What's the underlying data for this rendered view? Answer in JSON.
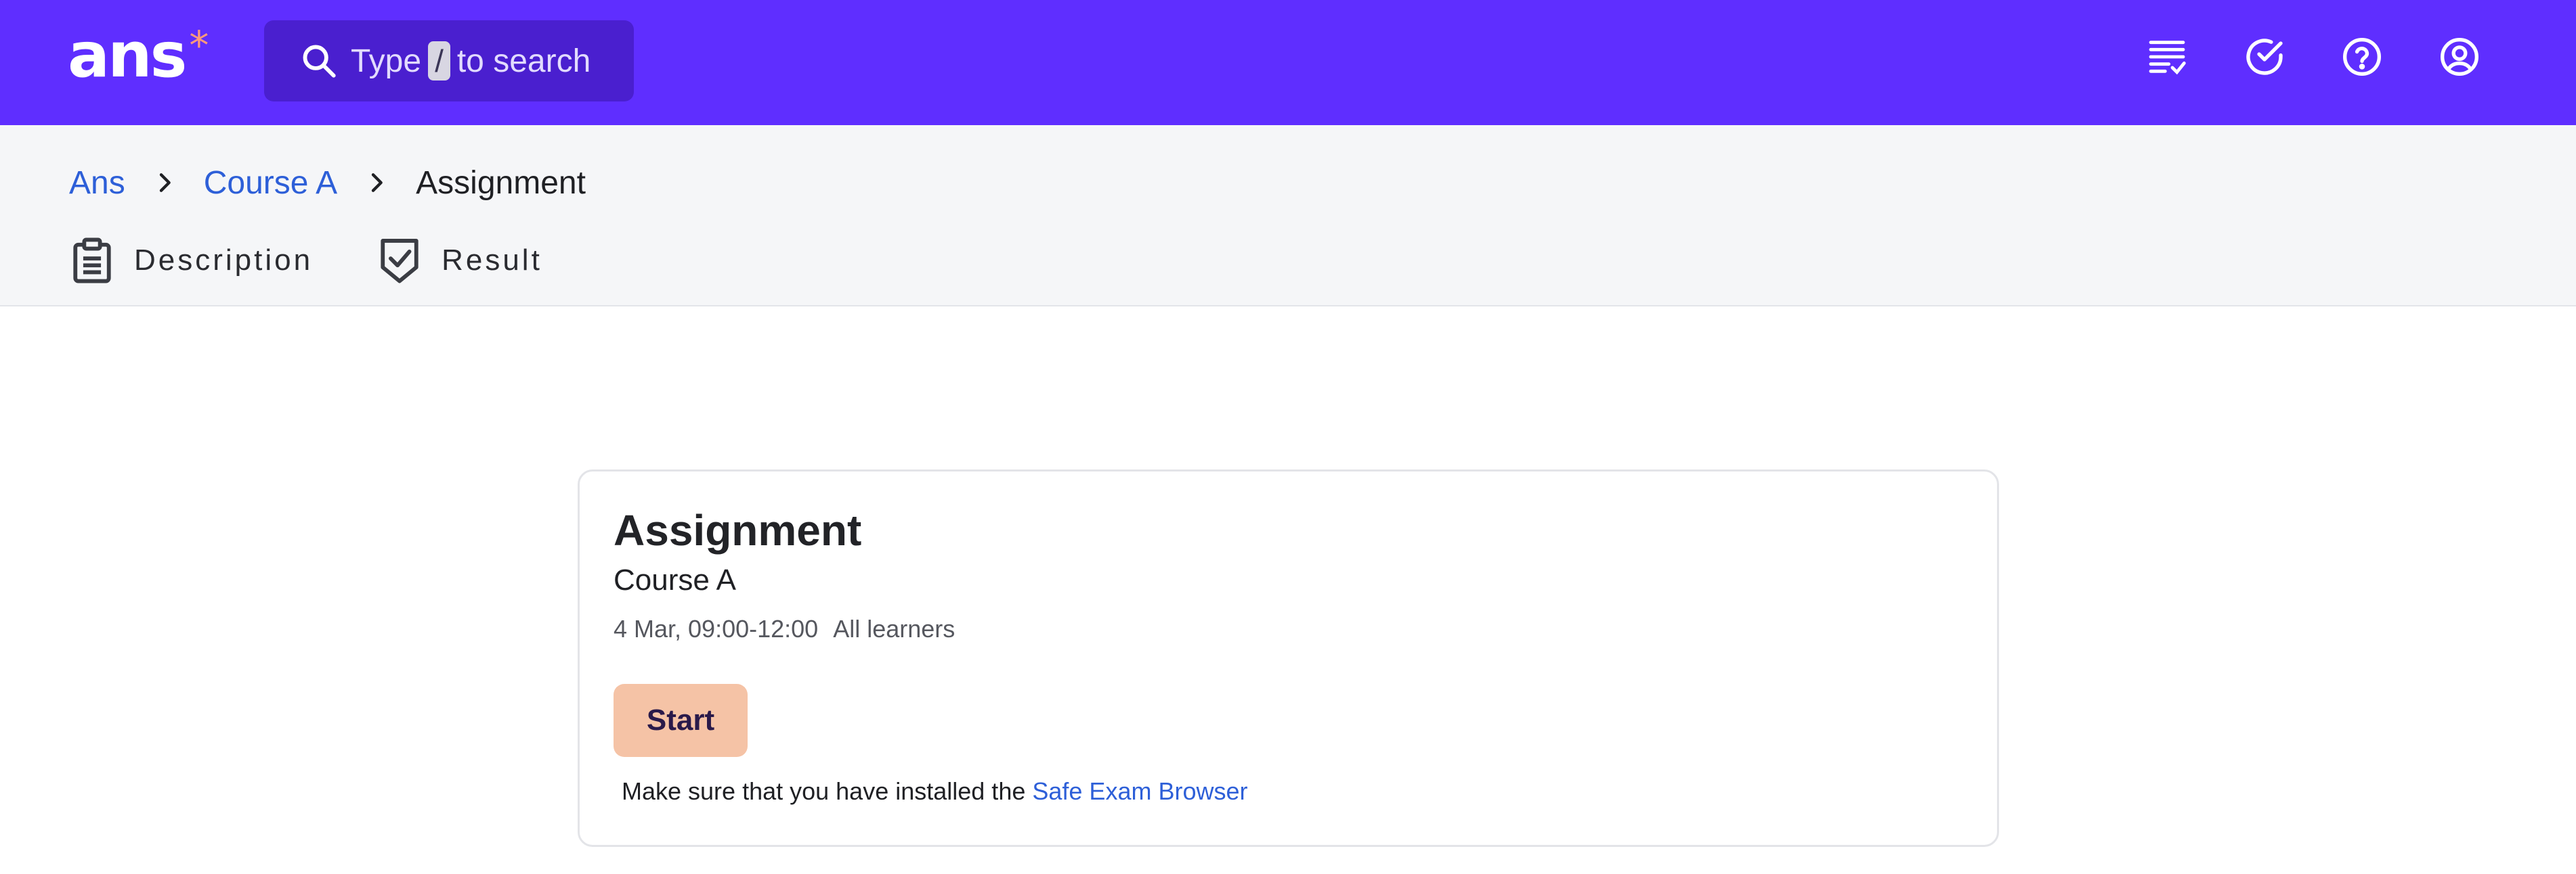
{
  "topbar": {
    "logo_text": "ans",
    "logo_mark": "*",
    "search": {
      "before": "Type",
      "key": "/",
      "after": "to search"
    },
    "icons": [
      "task-list-icon",
      "check-circle-icon",
      "help-circle-icon",
      "user-account-icon"
    ]
  },
  "breadcrumb": {
    "items": [
      {
        "label": "Ans"
      },
      {
        "label": "Course A"
      },
      {
        "label": "Assignment"
      }
    ]
  },
  "tabs": [
    {
      "label": "Description",
      "icon": "clipboard-icon"
    },
    {
      "label": "Result",
      "icon": "shield-check-icon"
    }
  ],
  "card": {
    "title": "Assignment",
    "course": "Course A",
    "date": "4 Mar, 09:00-12:00",
    "audience": "All learners",
    "start_label": "Start",
    "note_prefix": "Make sure that you have installed the",
    "note_link": "Safe Exam Browser"
  },
  "colors": {
    "brand": "#5f2eff",
    "search_bg": "#4a1fcf",
    "link": "#2d5fd8",
    "start_button": "#f5c3a6",
    "logo_mark": "#ff9a7a"
  }
}
